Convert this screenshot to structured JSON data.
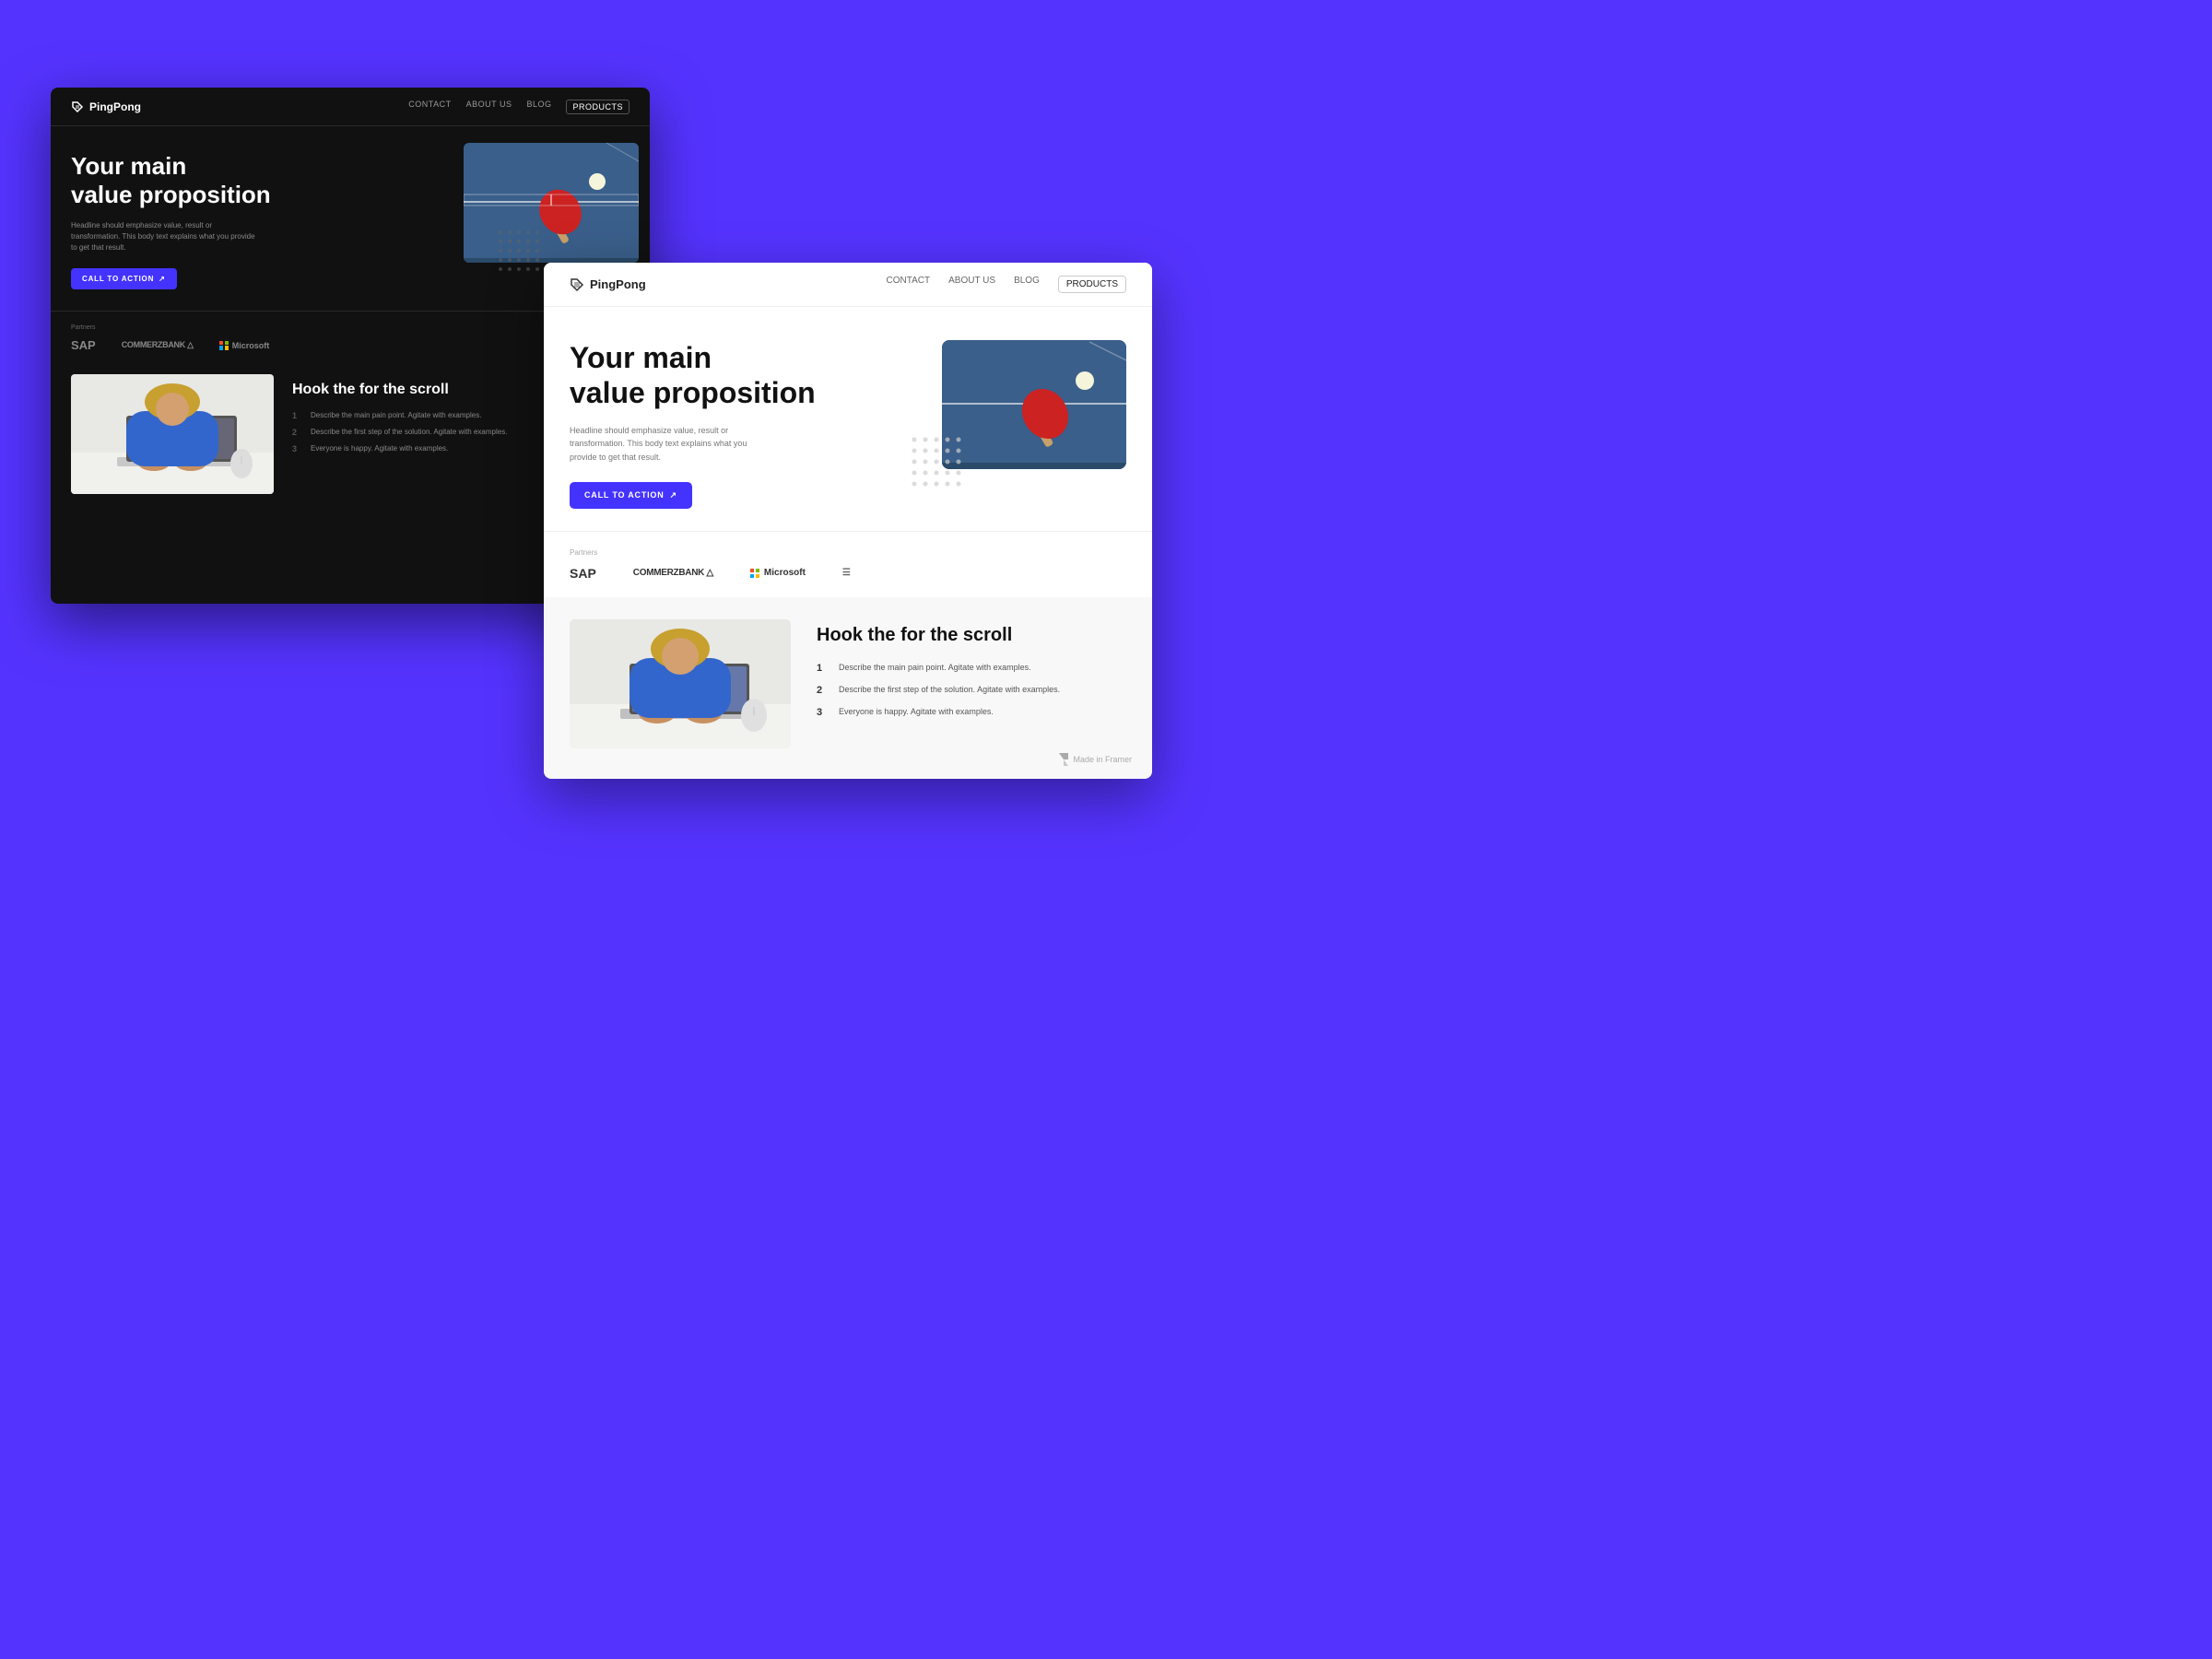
{
  "background": {
    "color": "#5533ff"
  },
  "dark_card": {
    "nav": {
      "logo": "PingPong",
      "links": [
        "CONTACT",
        "ABOUT US",
        "BLOG",
        "PRODUCTS"
      ]
    },
    "hero": {
      "title_line1": "Your main",
      "title_line2": "value proposition",
      "subtitle": "Headline should emphasize value, result or transformation. This body text explains what you provide to get that result.",
      "cta_label": "CALL TO ACTION",
      "cta_arrow": "→"
    },
    "partners": {
      "label": "Partners",
      "logos": [
        "SAP",
        "COMMERZBANK",
        "Microsoft"
      ]
    },
    "section2": {
      "title": "Hook the for the scroll",
      "items": [
        "Describe the main pain point. Agitate with examples.",
        "Describe the first step of the solution. Agitate with examples.",
        "Everyone is happy. Agitate with examples."
      ]
    }
  },
  "light_card": {
    "nav": {
      "logo": "PingPong",
      "links": [
        "CONTACT",
        "ABOUT US",
        "BLOG",
        "PRODUCTS"
      ]
    },
    "hero": {
      "title_line1": "Your main",
      "title_line2": "value proposition",
      "subtitle": "Headline should emphasize value, result or transformation. This body text explains what you provide to get that result.",
      "cta_label": "CALL TO ACTION",
      "cta_arrow": "→"
    },
    "partners": {
      "label": "Partners",
      "logos": [
        "SAP",
        "COMMERZBANK",
        "Microsoft"
      ]
    },
    "section2": {
      "title": "Hook the for the scroll",
      "items": [
        "Describe the main pain point. Agitate with examples.",
        "Describe the first step of the solution. Agitate with examples.",
        "Everyone is happy. Agitate with examples."
      ]
    },
    "framer_badge": "Made in Framer"
  },
  "icons": {
    "logo_symbol": "✦",
    "arrow_right": "↗"
  }
}
